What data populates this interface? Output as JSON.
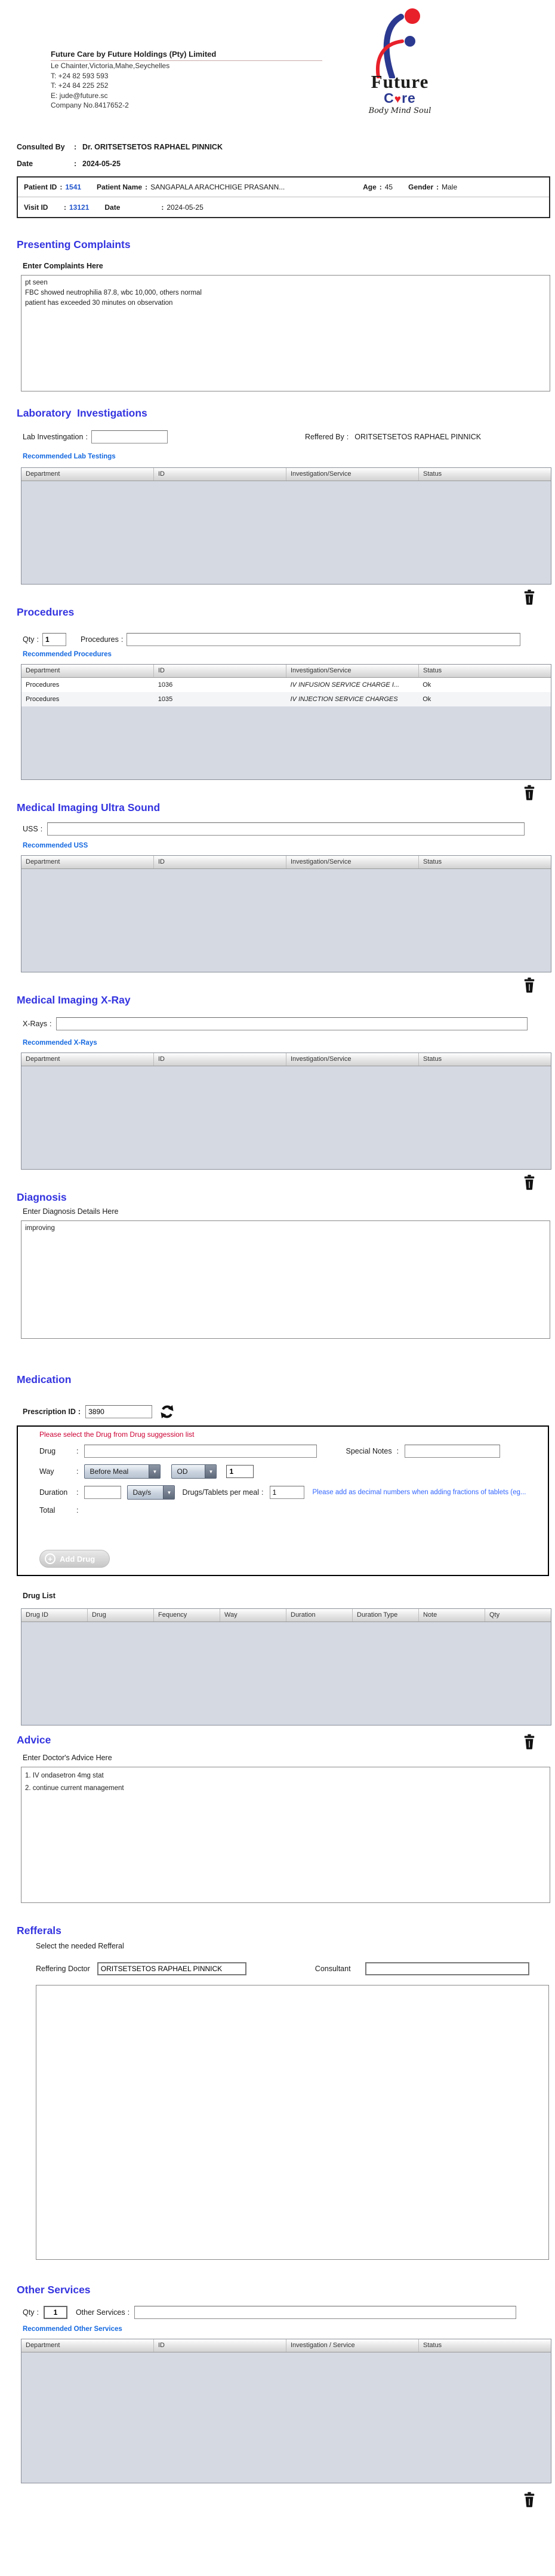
{
  "ui": {
    "colon": ":"
  },
  "colors": {
    "heading_blue": "#3434e0",
    "link_blue": "#1569e0",
    "id_blue": "#2255cc",
    "warning_red": "#cc0033",
    "note_blue": "#3366ff",
    "logo_blue": "#2b3990",
    "logo_red": "#e8202a",
    "table_body_gray": "#d4d9e2"
  },
  "company": {
    "title": "Future Care by Future Holdings (Pty) Limited",
    "address": "Le Chainter,Victoria,Mahe,Seychelles",
    "phone1": "T: +24  82 593 593",
    "phone2": "T: +24  84 225 252",
    "email": "E: jude@future.sc",
    "company_no": "Company No.8417652-2",
    "logo_word1": "Future",
    "logo_word2_start": "C",
    "logo_heart": "♥",
    "logo_word2_end": "re",
    "logo_tagline": "Body Mind Soul"
  },
  "consultation": {
    "consulted_by_label": "Consulted By",
    "consulted_by": "Dr.  ORITSETSETOS RAPHAEL PINNICK",
    "date_label": "Date",
    "date": "2024-05-25"
  },
  "patient_bar": {
    "patient_id_label": "Patient ID",
    "patient_id": "1541",
    "patient_name_label": "Patient Name",
    "patient_name": "SANGAPALA ARACHCHIGE PRASANN...",
    "age_label": "Age",
    "age": "45",
    "gender_label": "Gender",
    "gender": "Male",
    "visit_id_label": "Visit ID",
    "visit_id": "13121",
    "visit_date_label": "Date",
    "visit_date": "2024-05-25"
  },
  "presenting_complaints": {
    "title": "Presenting Complaints",
    "label": "Enter Complaints Here",
    "text": "pt seen\nFBC showed neutrophilia 87.8, wbc 10,000, others normal\npatient has exceeded 30 minutes on observation"
  },
  "laboratory": {
    "title": "Laboratory  Investigations",
    "field_label": "Lab Investingation",
    "field_value": "",
    "referred_by_label": "Reffered By",
    "referred_by": "ORITSETSETOS RAPHAEL PINNICK",
    "link": "Recommended Lab Testings",
    "columns": [
      "Department",
      "ID",
      "Investigation/Service",
      "Status"
    ]
  },
  "procedures": {
    "title": "Procedures",
    "qty_label": "Qty",
    "qty_value": "1",
    "field_label": "Procedures",
    "field_value": "",
    "link": "Recommended Procedures",
    "columns": [
      "Department",
      "ID",
      "Investigation/Service",
      "Status"
    ],
    "rows": [
      {
        "department": "Procedures",
        "id": "1036",
        "service": "IV INFUSION SERVICE CHARGE I...",
        "status": "Ok"
      },
      {
        "department": "Procedures",
        "id": "1035",
        "service": "IV INJECTION SERVICE CHARGES",
        "status": "Ok"
      }
    ]
  },
  "ultrasound": {
    "title": "Medical Imaging Ultra Sound",
    "field_label": "USS",
    "field_value": "",
    "link": "Recommended USS",
    "columns": [
      "Department",
      "ID",
      "Investigation/Service",
      "Status"
    ]
  },
  "xray": {
    "title": "Medical Imaging X-Ray",
    "field_label": "X-Rays",
    "field_value": "",
    "link": "Recommended X-Rays",
    "columns": [
      "Department",
      "ID",
      "Investigation/Service",
      "Status"
    ]
  },
  "diagnosis": {
    "title": "Diagnosis",
    "label": "Enter Diagnosis Details Here",
    "text": "improving"
  },
  "medication": {
    "title": "Medication",
    "prescription_id_label": "Prescription ID",
    "prescription_id": "3890",
    "warning": "Please select the Drug from Drug suggession list",
    "drug_label": "Drug",
    "drug_value": "",
    "special_notes_label": "Special Notes",
    "special_notes_value": "",
    "way_label": "Way",
    "way_option": "Before Meal",
    "frequency_option": "OD",
    "way_qty": "1",
    "duration_label": "Duration",
    "duration_value": "",
    "duration_type_option": "Day/s",
    "per_meal_label": "Drugs/Tablets per meal",
    "per_meal_value": "1",
    "decimal_note": "Please add as decimal numbers when adding fractions of tablets (eg...",
    "total_label": "Total",
    "add_drug_label": "Add Drug",
    "drug_list_label": "Drug List",
    "drug_columns": [
      "Drug ID",
      "Drug",
      "Fequency",
      "Way",
      "Duration",
      "Duration Type",
      "Note",
      "Qty"
    ]
  },
  "advice": {
    "title": "Advice",
    "label": "Enter Doctor's Advice Here",
    "text": "1. IV ondasetron 4mg stat\n2. continue current management"
  },
  "referrals": {
    "title": "Refferals",
    "label": "Select the needed Refferal",
    "referring_doctor_label": "Reffering Doctor",
    "referring_doctor": "ORITSETSETOS RAPHAEL PINNICK",
    "consultant_label": "Consultant",
    "consultant": ""
  },
  "other_services": {
    "title": "Other Services",
    "qty_label": "Qty",
    "qty_value": "1",
    "field_label": "Other Services",
    "field_value": "",
    "link": "Recommended Other Services",
    "columns": [
      "Department",
      "ID",
      "Investigation / Service",
      "Status"
    ]
  }
}
